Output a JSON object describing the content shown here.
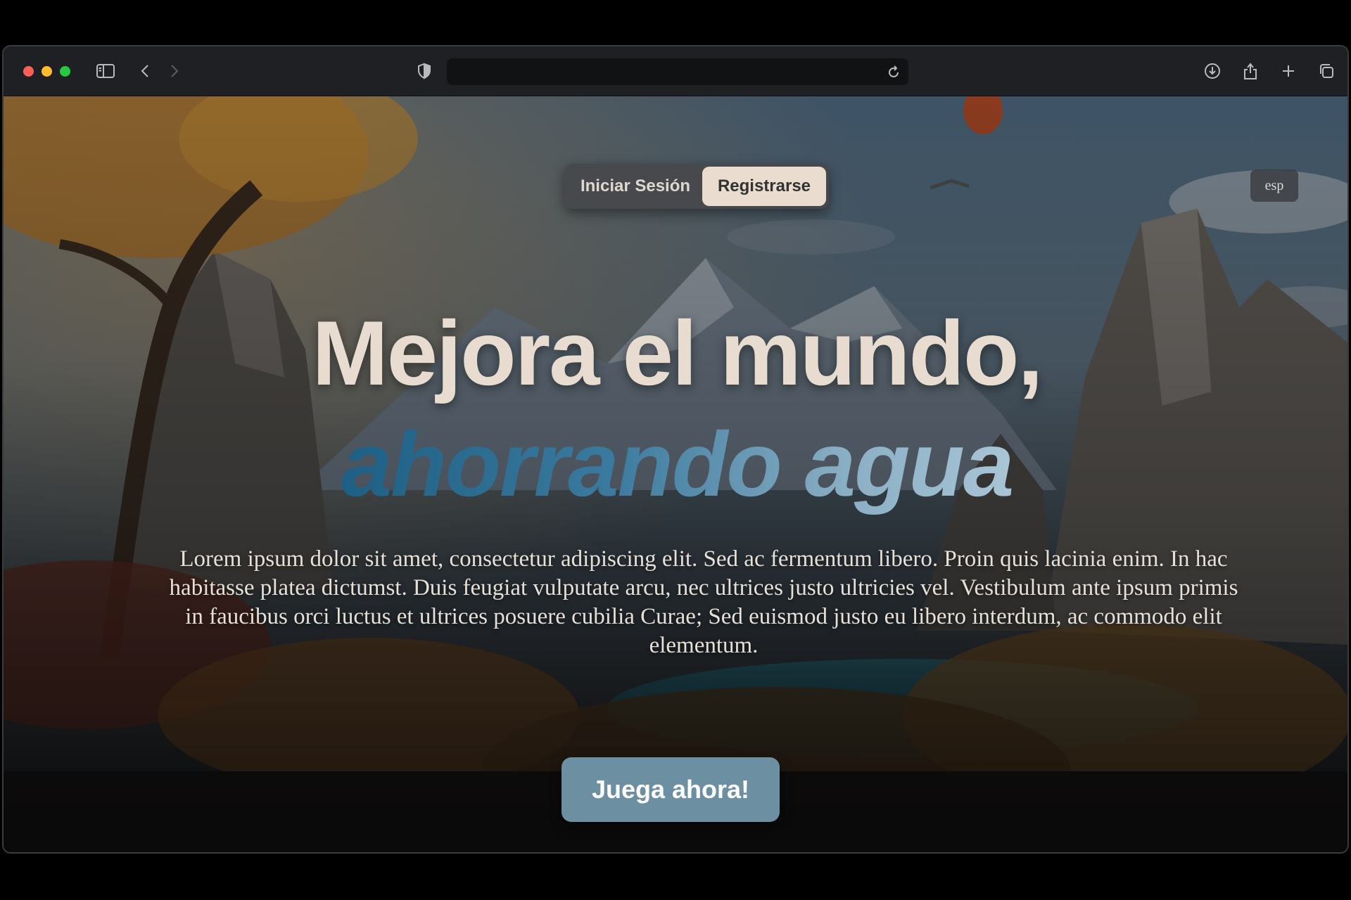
{
  "browser": {
    "address_value": "",
    "icons": [
      "sidebar-icon",
      "back-icon",
      "forward-icon",
      "shield-icon",
      "reload-icon",
      "download-icon",
      "share-icon",
      "new-tab-icon",
      "tabs-overview-icon"
    ]
  },
  "header": {
    "login_label": "Iniciar Sesión",
    "register_label": "Registrarse",
    "language_label": "esp"
  },
  "hero": {
    "title_line1": "Mejora el mundo,",
    "title_line2": "ahorrando agua",
    "description": "Lorem ipsum dolor sit amet, consectetur adipiscing elit. Sed ac fermentum libero. Proin quis lacinia enim. In hac habitasse platea dictumst. Duis feugiat vulputate arcu, nec ultrices justo ultricies vel. Vestibulum ante ipsum primis in faucibus orci luctus et ultrices posuere cubilia Curae; Sed euismod justo eu libero interdum, ac commodo elit elementum.",
    "cta_label": "Juega ahora!"
  },
  "colors": {
    "accent": "#6d8fa2",
    "title": "#e8dcd1",
    "register_bg": "#ebdcd0",
    "gradient_start": "#1e5f85",
    "gradient_end": "#a9c5d6"
  }
}
